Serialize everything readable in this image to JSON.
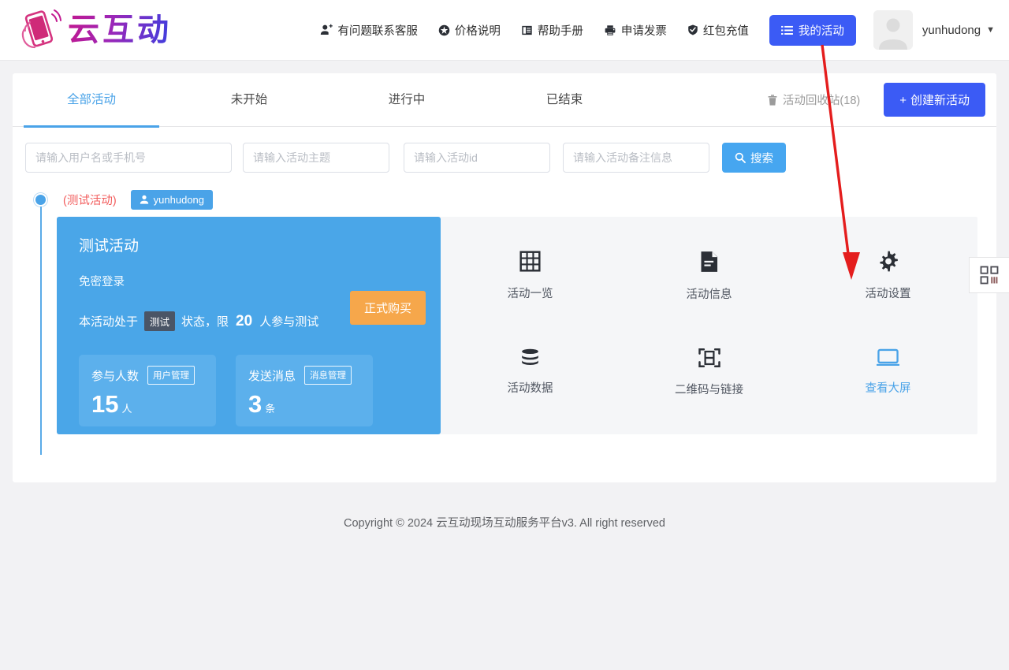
{
  "header": {
    "logo_text": "云互动",
    "logo_icon": "hand-holding-phone-icon",
    "nav": [
      {
        "label": "有问题联系客服",
        "icon": "customer-service-icon"
      },
      {
        "label": "价格说明",
        "icon": "price-tag-icon"
      },
      {
        "label": "帮助手册",
        "icon": "book-icon"
      },
      {
        "label": "申请发票",
        "icon": "printer-icon"
      },
      {
        "label": "红包充值",
        "icon": "shield-check-icon"
      }
    ],
    "my_activity_label": "我的活动",
    "my_activity_icon": "list-icon",
    "username": "yunhudong",
    "caret": "▼",
    "accent_blue": "#3b5bf5"
  },
  "tabs": [
    {
      "label": "全部活动",
      "active": true
    },
    {
      "label": "未开始",
      "active": false
    },
    {
      "label": "进行中",
      "active": false
    },
    {
      "label": "已结束",
      "active": false
    }
  ],
  "toolbar": {
    "recycle_label": "活动回收站(18)",
    "recycle_icon": "trash-icon",
    "create_plus": "+",
    "create_label": "创建新活动"
  },
  "filters": {
    "user_placeholder": "请输入用户名或手机号",
    "topic_placeholder": "请输入活动主题",
    "id_placeholder": "请输入活动id",
    "note_placeholder": "请输入活动备注信息",
    "search_label": "搜索",
    "search_icon": "magnifier-icon",
    "search_color": "#46a6f0"
  },
  "activity": {
    "test_tag": "(测试活动)",
    "owner": "yunhudong",
    "owner_icon": "user-icon",
    "card": {
      "title": "测试活动",
      "subtitle": "免密登录",
      "status_prefix": "本活动处于",
      "status_chip": "测试",
      "status_mid": "状态，限",
      "status_number": "20",
      "status_suffix": "人参与测试",
      "buy_label": "正式购买",
      "buy_color": "#f6a74b",
      "card_color": "#4aa6e8"
    },
    "stats": [
      {
        "label": "参与人数",
        "button": "用户管理",
        "value": "15",
        "unit": "人"
      },
      {
        "label": "发送消息",
        "button": "消息管理",
        "value": "3",
        "unit": "条"
      }
    ],
    "actions": [
      {
        "label": "活动一览",
        "icon": "grid-icon",
        "highlight": false
      },
      {
        "label": "活动信息",
        "icon": "document-icon",
        "highlight": false
      },
      {
        "label": "活动设置",
        "icon": "gear-icon",
        "highlight": false
      },
      {
        "label": "活动数据",
        "icon": "database-icon",
        "highlight": false
      },
      {
        "label": "二维码与链接",
        "icon": "qr-scan-icon",
        "highlight": false
      },
      {
        "label": "查看大屏",
        "icon": "monitor-icon",
        "highlight": true
      }
    ]
  },
  "side_widget": {
    "icon": "qr-code-icon"
  },
  "footer": {
    "text": "Copyright © 2024 云互动现场互动服务平台v3. All right reserved"
  },
  "annotation": {
    "arrow_color": "#e41d1d",
    "points_at": "活动设置"
  }
}
